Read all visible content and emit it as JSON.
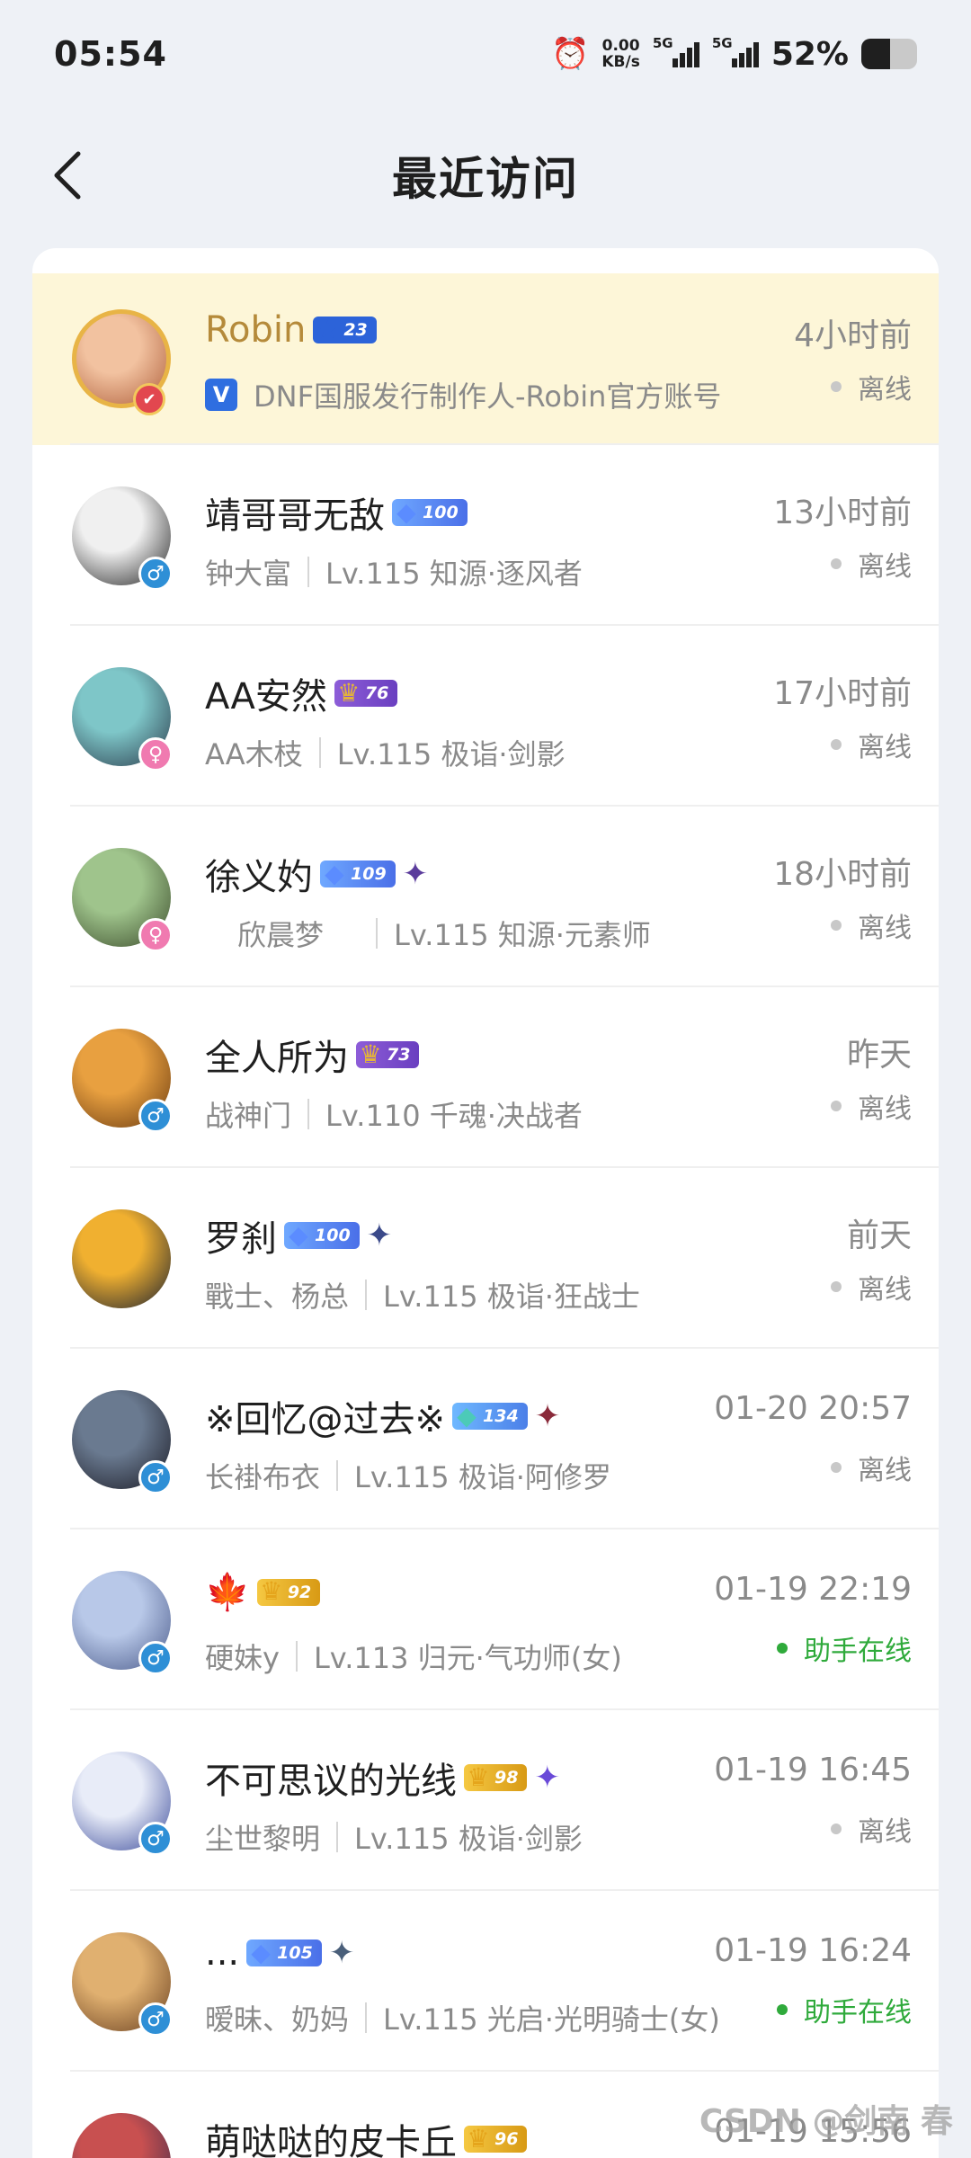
{
  "status_bar": {
    "time": "05:54",
    "net_speed_value": "0.00",
    "net_speed_unit": "KB/s",
    "sim1": "5G",
    "sim2": "5G",
    "battery_percent": "52%",
    "battery_level": 0.52
  },
  "header": {
    "title": "最近访问"
  },
  "visitors": [
    {
      "name": "Robin",
      "badge_type": "star",
      "badge_level": "23",
      "emblem": "",
      "sub_primary": "DNF国服发行制作人-Robin官方账号",
      "sub_secondary": "",
      "verified_label": "V",
      "time": "4小时前",
      "status": "离线",
      "online": false,
      "gender": "",
      "avatar_colors": [
        "#f2c2a0",
        "#b0603c"
      ]
    },
    {
      "name": "靖哥哥无敌",
      "badge_type": "blue",
      "badge_level": "100",
      "emblem": "",
      "sub_primary": "钟大富",
      "sub_secondary": "Lv.115 知源·逐风者",
      "time": "13小时前",
      "status": "离线",
      "online": false,
      "gender": "♂",
      "avatar_colors": [
        "#f0f0f0",
        "#222222"
      ]
    },
    {
      "name": "AA安然",
      "badge_type": "purple",
      "badge_level": "76",
      "emblem": "",
      "sub_primary": "AA木枝",
      "sub_secondary": "Lv.115 极诣·剑影",
      "time": "17小时前",
      "status": "离线",
      "online": false,
      "gender": "♀",
      "avatar_colors": [
        "#7ec6c8",
        "#2a3a4a"
      ]
    },
    {
      "name": "徐义妁",
      "badge_type": "blue",
      "badge_level": "109",
      "emblem": "purple",
      "sub_primary": "欣晨梦",
      "sub_secondary": "Lv.115 知源·元素师",
      "time": "18小时前",
      "status": "离线",
      "online": false,
      "gender": "♀",
      "avatar_colors": [
        "#9fc48c",
        "#3a4a2a"
      ]
    },
    {
      "name": "全人所为",
      "badge_type": "purple",
      "badge_level": "73",
      "emblem": "",
      "sub_primary": "战神门",
      "sub_secondary": "Lv.110 千魂·决战者",
      "time": "昨天",
      "status": "离线",
      "online": false,
      "gender": "♂",
      "avatar_colors": [
        "#e8a040",
        "#6a3a10"
      ]
    },
    {
      "name": "罗刹",
      "badge_type": "blue",
      "badge_level": "100",
      "emblem": "navy",
      "sub_primary": "戰士、杨总",
      "sub_secondary": "Lv.115 极诣·狂战士",
      "time": "前天",
      "status": "离线",
      "online": false,
      "gender": "",
      "avatar_colors": [
        "#f0b030",
        "#1a2030"
      ]
    },
    {
      "name": "※回忆@过去※",
      "badge_type": "teal",
      "badge_level": "134",
      "emblem": "crimson",
      "sub_primary": "长褂布衣",
      "sub_secondary": "Lv.115 极诣·阿修罗",
      "time": "01-20 20:57",
      "status": "离线",
      "online": false,
      "gender": "♂",
      "avatar_colors": [
        "#6a7a90",
        "#1a1a24"
      ]
    },
    {
      "name": "🍁",
      "badge_type": "gold",
      "badge_level": "92",
      "emblem": "",
      "sub_primary": "硬妹y",
      "sub_secondary": "Lv.113 归元·气功师(女)",
      "time": "01-19 22:19",
      "status": "助手在线",
      "online": true,
      "gender": "♂",
      "avatar_colors": [
        "#b8c8e8",
        "#4a5a8a"
      ]
    },
    {
      "name": "不可思议的光线",
      "badge_type": "gold",
      "badge_level": "98",
      "emblem": "violet",
      "sub_primary": "尘世黎明",
      "sub_secondary": "Lv.115 极诣·剑影",
      "time": "01-19 16:45",
      "status": "离线",
      "online": false,
      "gender": "♂",
      "avatar_colors": [
        "#e8ecf8",
        "#3a4a9a"
      ]
    },
    {
      "name": "...",
      "badge_type": "blue",
      "badge_level": "105",
      "emblem": "steel",
      "sub_primary": "暧昧、奶妈",
      "sub_secondary": "Lv.115 光启·光明骑士(女)",
      "time": "01-19 16:24",
      "status": "助手在线",
      "online": true,
      "gender": "♂",
      "avatar_colors": [
        "#e0b070",
        "#6a4020"
      ]
    },
    {
      "name": "萌哒哒的皮卡丘",
      "badge_type": "gold",
      "badge_level": "96",
      "emblem": "",
      "sub_primary": "",
      "sub_secondary": "",
      "time": "01-19 15:56",
      "status": "",
      "online": false,
      "gender": "",
      "avatar_colors": [
        "#c85050",
        "#3a2a4a"
      ]
    }
  ],
  "watermark": "CSDN @剑南 春"
}
